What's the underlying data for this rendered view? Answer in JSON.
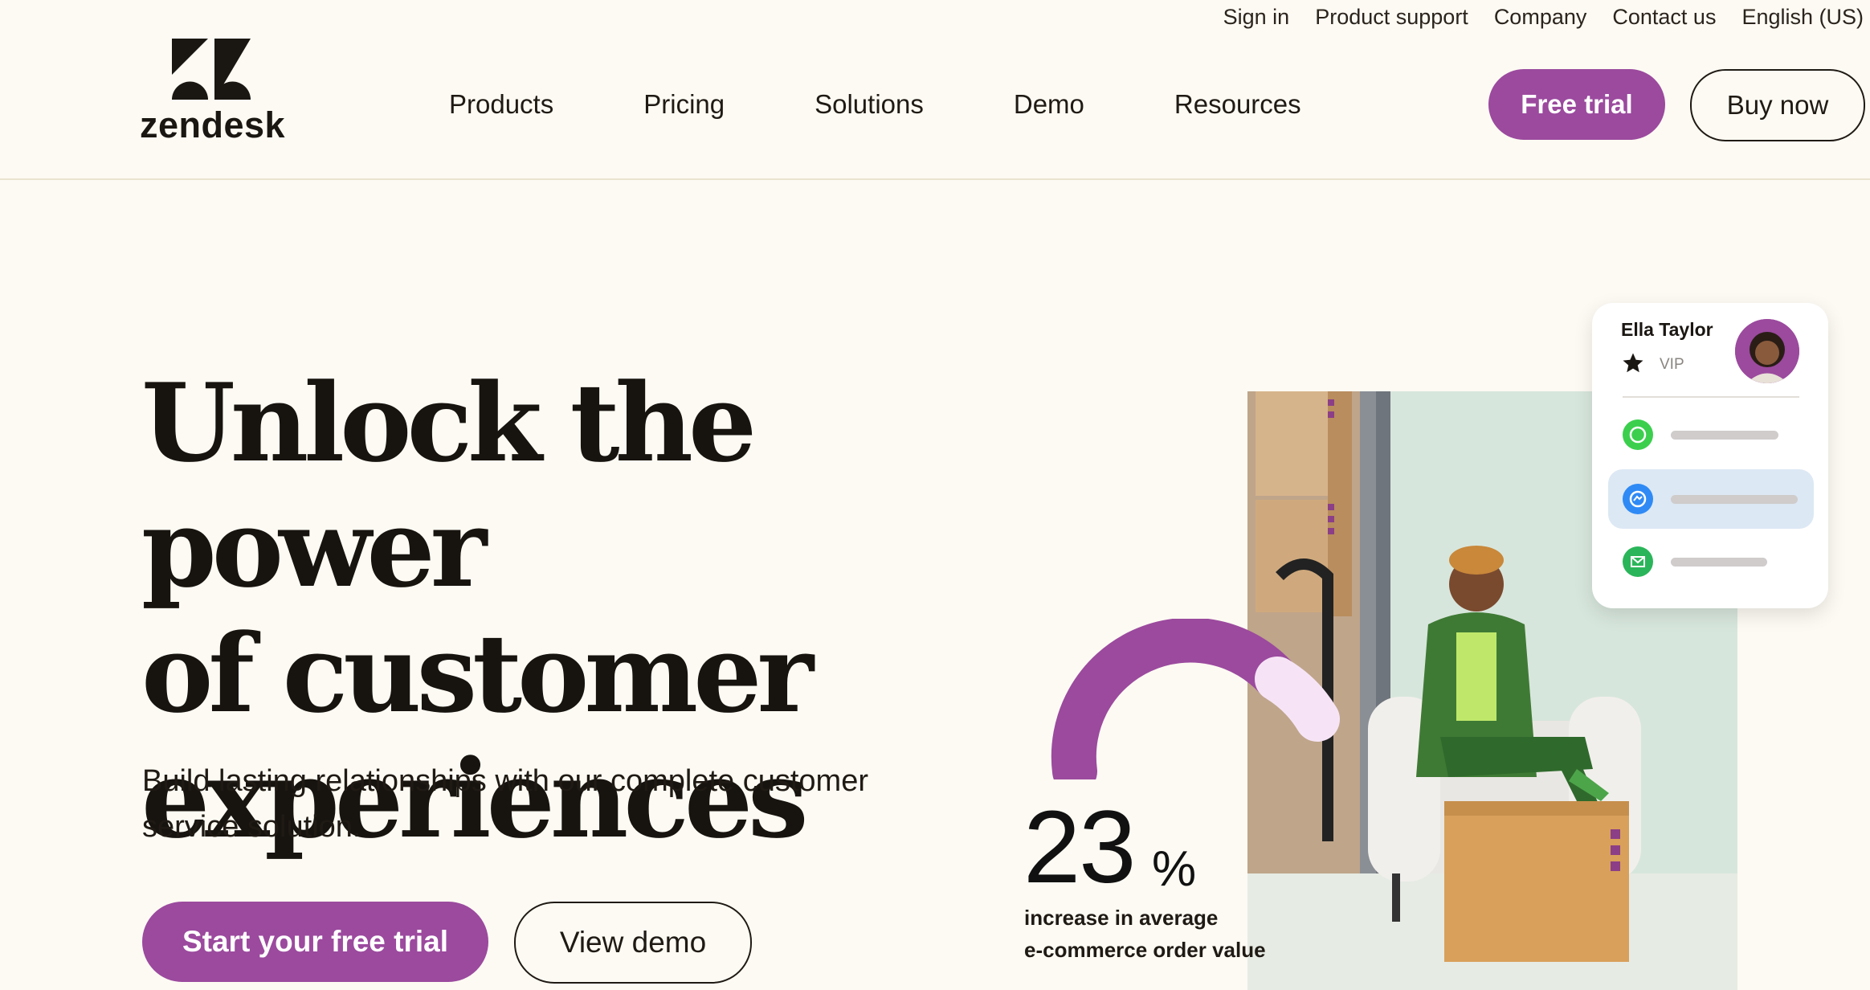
{
  "utility_nav": [
    "Sign in",
    "Product support",
    "Company",
    "Contact us",
    "English (US)"
  ],
  "logo": {
    "wordmark": "zendesk"
  },
  "main_nav": [
    "Products",
    "Pricing",
    "Solutions",
    "Demo",
    "Resources"
  ],
  "header_buttons": {
    "free_trial": "Free trial",
    "buy_now": "Buy now"
  },
  "hero": {
    "title_lines": [
      "Unlock the power",
      "of customer",
      "experiences"
    ],
    "subtitle": "Build lasting relationships with our complete customer service solution.",
    "primary_cta": "Start your free trial",
    "secondary_cta": "View demo"
  },
  "stat": {
    "number": "23",
    "unit": "%",
    "caption_lines": [
      "increase in average",
      "e-commerce order value"
    ]
  },
  "profile_card": {
    "name": "Ella Taylor",
    "tier": "VIP",
    "channels": [
      {
        "icon": "whatsapp-icon",
        "color": "#3ccf4e"
      },
      {
        "icon": "messenger-icon",
        "color": "#2f8af5",
        "active": true
      },
      {
        "icon": "email-icon",
        "color": "#2bb55a"
      }
    ]
  },
  "colors": {
    "accent": "#9b4a9e",
    "background": "#fdfaf3",
    "gauge_light": "#f6e4f6"
  }
}
